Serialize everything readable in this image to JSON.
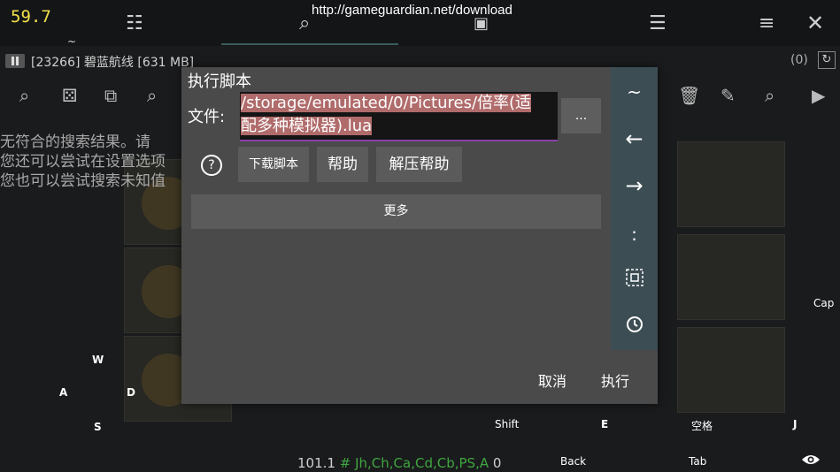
{
  "topbar": {
    "fps": "59.7",
    "url": "http://gameguardian.net/download",
    "tilde": "~"
  },
  "process": {
    "text": "[23266] 碧蓝航线 [631 MB]",
    "count": "(0)"
  },
  "search_messages": [
    "无符合的搜索结果。请",
    "您还可以尝试在设置选项",
    "您也可以尝试搜索未知值"
  ],
  "dialog": {
    "title": "执行脚本",
    "file_label": "文件:",
    "file_value_line1": "/storage/emulated/0/Pictures/倍率(适",
    "file_value_line2": "配多种模拟器).lua",
    "browse_label": "...",
    "help_icon": "?",
    "download_label": "下载脚本",
    "help_label": "帮助",
    "unzip_help_label": "解压帮助",
    "more_label": "更多",
    "cancel_label": "取消",
    "execute_label": "执行"
  },
  "side_keys": [
    "~",
    "←",
    "→",
    ":"
  ],
  "overlay_keys": {
    "w": "W",
    "a": "A",
    "d": "D",
    "s": "S",
    "shift": "Shift",
    "e": "E",
    "space": "空格",
    "j": "J",
    "back": "Back",
    "tab": "Tab",
    "cap": "Cap"
  },
  "status": {
    "value": "101.1",
    "hash": "#",
    "types": "Jh,Ch,Ca,Cd,Cb,PS,A",
    "count": "0"
  }
}
